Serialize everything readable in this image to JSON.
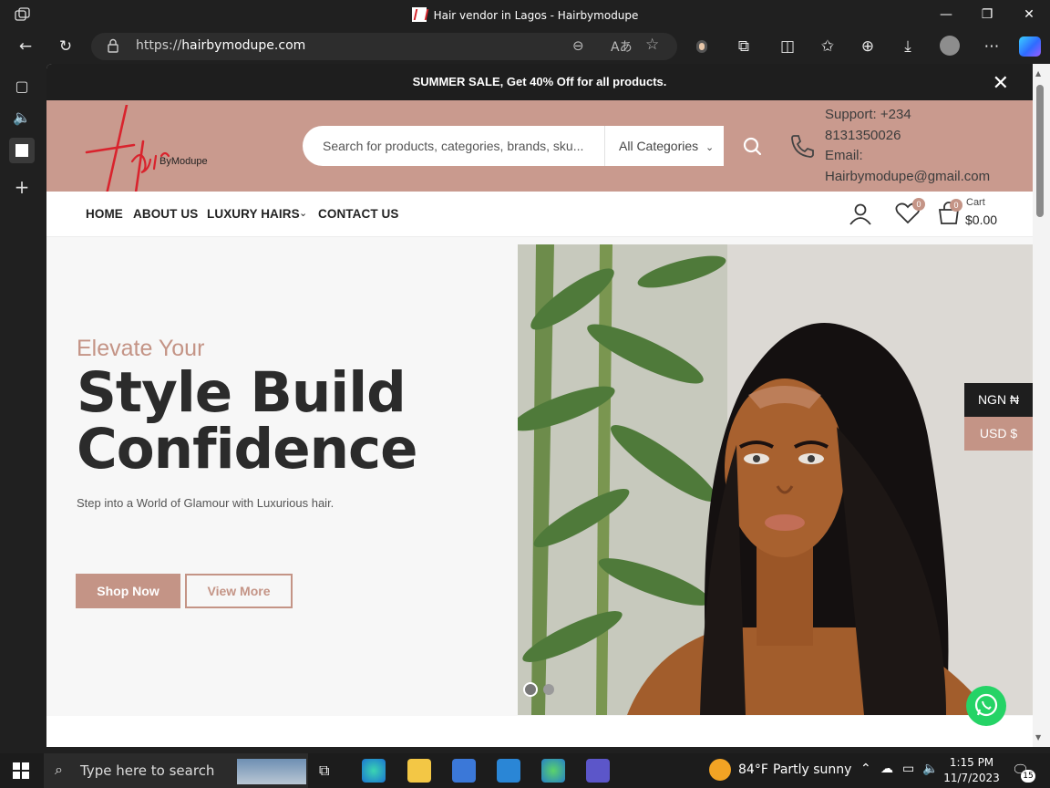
{
  "window": {
    "title": "Hair vendor in Lagos - Hairbymodupe",
    "minimize_icon": "minimize-icon",
    "restore_icon": "restore-icon",
    "close_icon": "close-icon"
  },
  "browser": {
    "url_prefix": "https://",
    "url_host": "hairbymodupe.com"
  },
  "promo": {
    "text": "SUMMER SALE, Get 40% Off for all products."
  },
  "header": {
    "logo_brand": "ByModupe",
    "search_placeholder": "Search for products, categories, brands, sku...",
    "category_label": "All Categories",
    "support_line1": "Support: +234",
    "support_line2": "8131350026",
    "email_label": "Email:",
    "email_value": "Hairbymodupe@gmail.com"
  },
  "nav": {
    "items": [
      "HOME",
      "ABOUT US",
      "LUXURY HAIRS",
      "CONTACT US"
    ],
    "wishlist_count": "0",
    "cart_count": "0",
    "cart_label": "Cart",
    "cart_total": "$0.00"
  },
  "hero": {
    "kicker": "Elevate Your",
    "heading_line1": "Style Build",
    "heading_line2": "Confidence",
    "subtext": "Step into a World of Glamour with Luxurious hair.",
    "primary_button": "Shop Now",
    "secondary_button": "View More"
  },
  "currency": {
    "options": [
      "NGN ₦",
      "USD $"
    ],
    "active": "NGN ₦"
  },
  "colors": {
    "accent": "#c49486",
    "header_bg": "#c99a8e",
    "promo_bg": "#1e1e1e"
  },
  "taskbar": {
    "search_placeholder": "Type here to search",
    "weather_temp": "84°F",
    "weather_text": "Partly sunny",
    "time": "1:15 PM",
    "date": "11/7/2023",
    "notification_count": "15"
  }
}
